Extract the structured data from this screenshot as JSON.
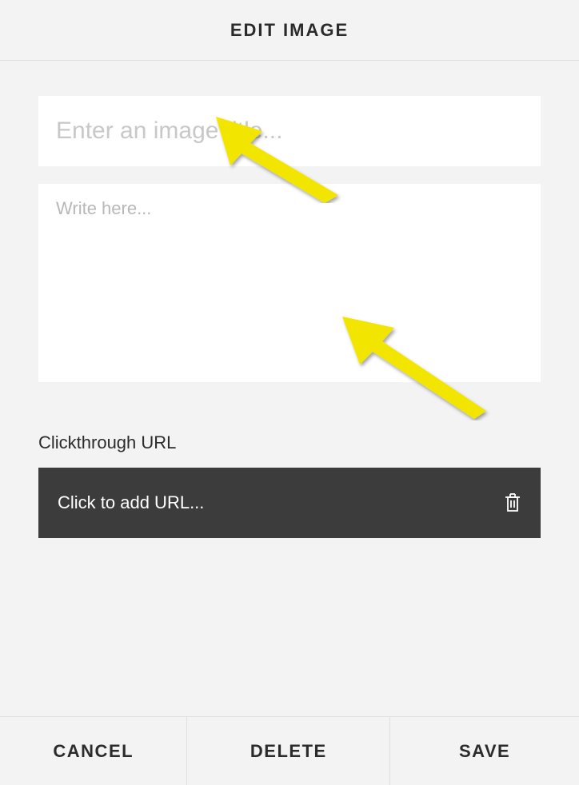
{
  "header": {
    "title": "EDIT IMAGE"
  },
  "titleInput": {
    "value": "",
    "placeholder": "Enter an image title..."
  },
  "description": {
    "value": "",
    "placeholder": "Write here..."
  },
  "clickthrough": {
    "label": "Clickthrough URL",
    "placeholder": "Click to add URL..."
  },
  "footer": {
    "cancel": "CANCEL",
    "delete": "DELETE",
    "save": "SAVE"
  },
  "annotations": {
    "arrowColor": "#f2e500"
  }
}
